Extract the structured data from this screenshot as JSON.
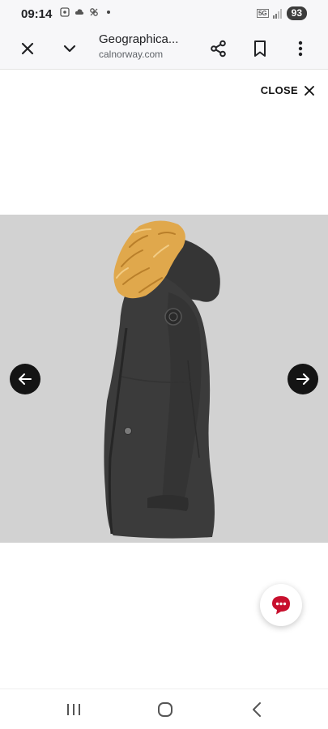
{
  "status_bar": {
    "time": "09:14",
    "network": "5G",
    "battery": "93"
  },
  "toolbar": {
    "title": "Geographica...",
    "domain": "calnorway.com"
  },
  "modal": {
    "close_label": "CLOSE"
  },
  "colors": {
    "toolbar_bg": "#f7f7f9",
    "image_bg": "#d2d2d2",
    "arrow_bg": "#141414",
    "chat_accent": "#c8102e",
    "fur_trim": "#e0a84c",
    "jacket": "#3b3b3b"
  },
  "icons": {
    "toolbar_close": "close-icon",
    "toolbar_minimize": "chevron-down-icon",
    "toolbar_share": "share-icon",
    "toolbar_bookmark": "bookmark-icon",
    "toolbar_more": "more-vertical-icon",
    "gallery_prev": "arrow-left-icon",
    "gallery_next": "arrow-right-icon",
    "chat": "chat-bubble-icon",
    "nav_recents": "recents-icon",
    "nav_home": "home-icon",
    "nav_back": "back-icon"
  }
}
